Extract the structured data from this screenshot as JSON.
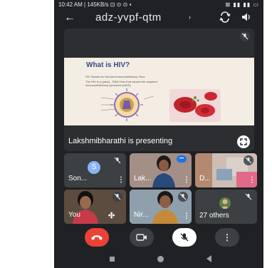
{
  "status": {
    "time_info": "10:42 AM | 145KB/s ⊡ ⊙ ⊙ ▪",
    "right_icons": "⊠ ▮▮ ▮▮ ▭"
  },
  "header": {
    "meeting_code": "adz-yvpf-qtm",
    "chevron": "›"
  },
  "presentation": {
    "slide_title": "What is HIV?",
    "bullets": [
      "HIV Stands for Human Immunodeficiency Virus",
      "The HIV is a (pass) - RNA Virus that causes the acquired",
      "immunodeficiency syndrome (AIDS)"
    ],
    "presenter_label": "Lakshmibharathi is presenting"
  },
  "tiles": [
    {
      "name": "Son...",
      "initial": "S",
      "avatar_color": "#8ab4f8"
    },
    {
      "name": "Lak..."
    },
    {
      "name": "D..."
    },
    {
      "name": "You"
    },
    {
      "name": "Nir..."
    },
    {
      "name": "27 others"
    }
  ],
  "colors": {
    "end_call": "#ea4335",
    "background": "#202124",
    "tile": "#3c4043",
    "accent": "#8ab4f8"
  }
}
